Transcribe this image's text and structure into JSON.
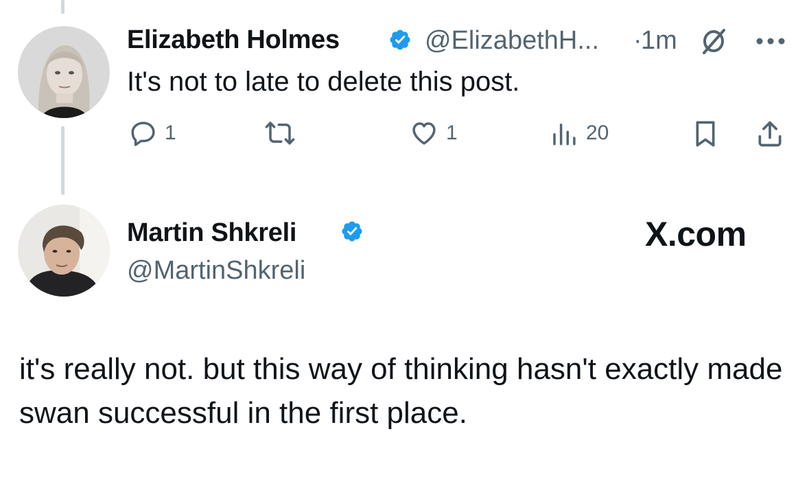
{
  "original_post": {
    "author_name": "Elizabeth Holmes",
    "author_handle": "@ElizabethH...",
    "separator": "·",
    "timestamp": "1m",
    "text": "It's not to late to delete this post.",
    "more_icon": "more-horizontal-icon",
    "grok_icon": "grok-icon",
    "actions": {
      "replies": "1",
      "reposts": "",
      "likes": "1",
      "views": "20"
    }
  },
  "reply_post": {
    "author_name": "Martin Shkreli",
    "author_handle": "@MartinShkreli",
    "source_label": "X.com",
    "text": "it's really not. but this way of thinking hasn't exactly made swan successful in the first place."
  },
  "colors": {
    "verified_blue": "#1d9bf0",
    "muted_gray": "#536471",
    "text_dark": "#0f1419",
    "thread_line": "#cfd9de"
  }
}
